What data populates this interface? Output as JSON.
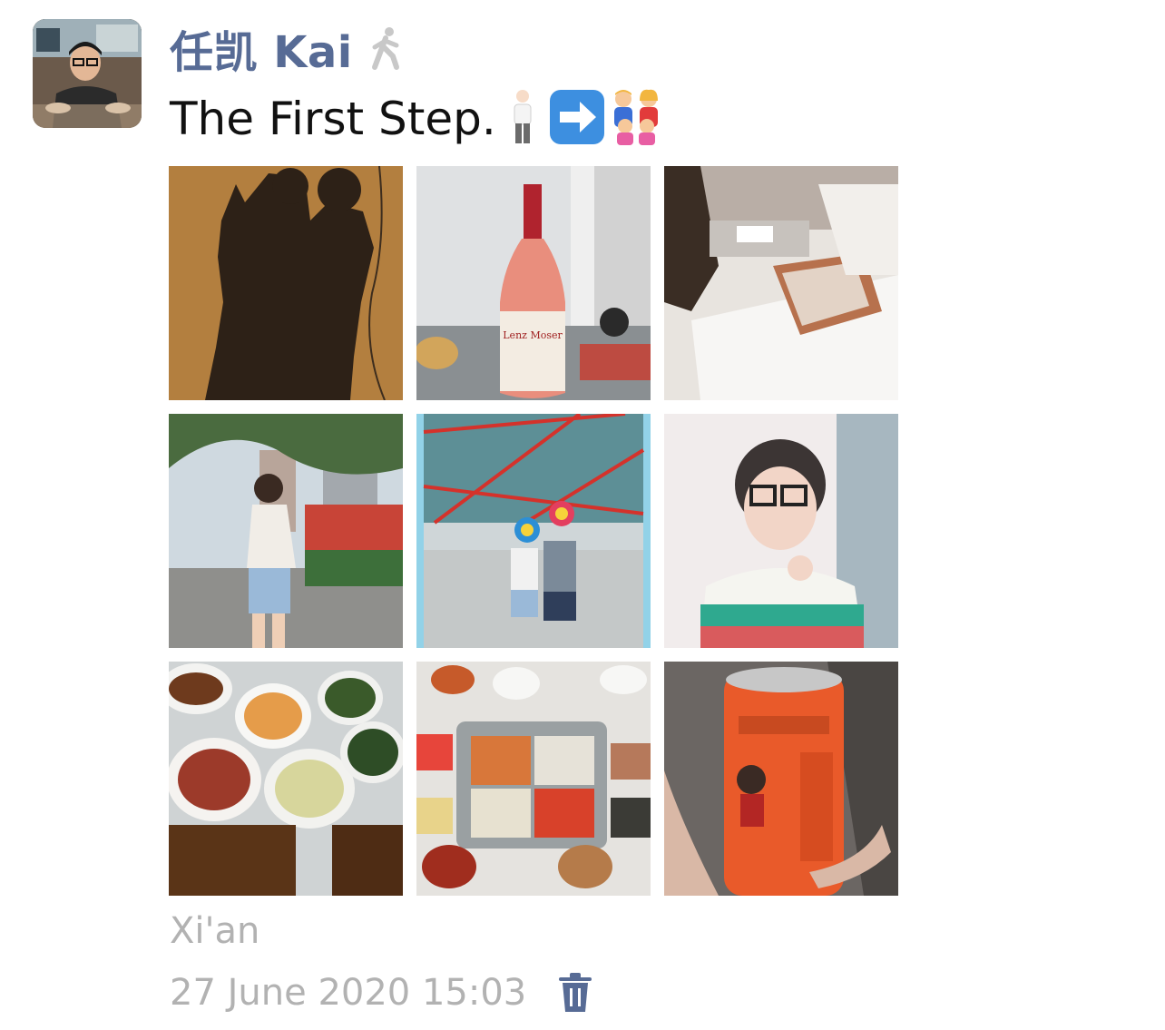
{
  "author": {
    "name": "任凯 Kai",
    "status_icon": "walking-person-icon"
  },
  "post": {
    "text": "The First Step.",
    "emojis": [
      "person-standing-emoji",
      "right-arrow-emoji",
      "family-emoji"
    ]
  },
  "photos": [
    {
      "name": "photo-shadows"
    },
    {
      "name": "photo-wine-bottle"
    },
    {
      "name": "photo-hotel-bed"
    },
    {
      "name": "photo-street-girl"
    },
    {
      "name": "photo-couple-flowers"
    },
    {
      "name": "photo-boy-glasses"
    },
    {
      "name": "photo-dinner-dishes"
    },
    {
      "name": "photo-hotpot"
    },
    {
      "name": "photo-soda-can"
    }
  ],
  "location": "Xi'an",
  "timestamp": "27 June 2020 15:03",
  "actions": {
    "delete_icon": "trash-icon"
  },
  "colors": {
    "name": "#576b95",
    "meta": "#b2b2b2",
    "text": "#111111"
  }
}
